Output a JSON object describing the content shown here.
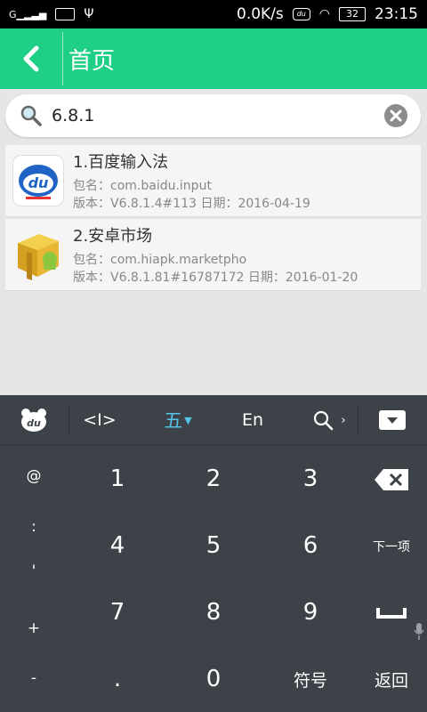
{
  "status_bar": {
    "signal": "G",
    "net_speed": "0.0K/s",
    "battery": "32",
    "time": "23:15"
  },
  "header": {
    "title": "首页"
  },
  "search": {
    "value": "6.8.1"
  },
  "results": [
    {
      "title": "1.百度输入法",
      "package": "包名：com.baidu.input",
      "version": "版本：V6.8.1.4#113   日期：2016-04-19"
    },
    {
      "title": "2.安卓市场",
      "package": "包名：com.hiapk.marketpho",
      "version": "版本：V6.8.1.81#16787172   日期：2016-01-20"
    }
  ],
  "keyboard": {
    "toolbar": {
      "cursor": "<I>",
      "mode": "五",
      "lang": "En"
    },
    "digits": [
      "1",
      "2",
      "3",
      "4",
      "5",
      "6",
      "7",
      "8",
      "9",
      "0"
    ],
    "dot": ".",
    "left_symbols": [
      "@",
      ":",
      "'",
      "+",
      "-"
    ],
    "next_label": "下一项",
    "symbols_label": "符号",
    "return_label": "返回"
  },
  "colors": {
    "accent": "#1fcf86",
    "keyboard_bg": "#3c4248",
    "mode_blue": "#55c3e6"
  }
}
